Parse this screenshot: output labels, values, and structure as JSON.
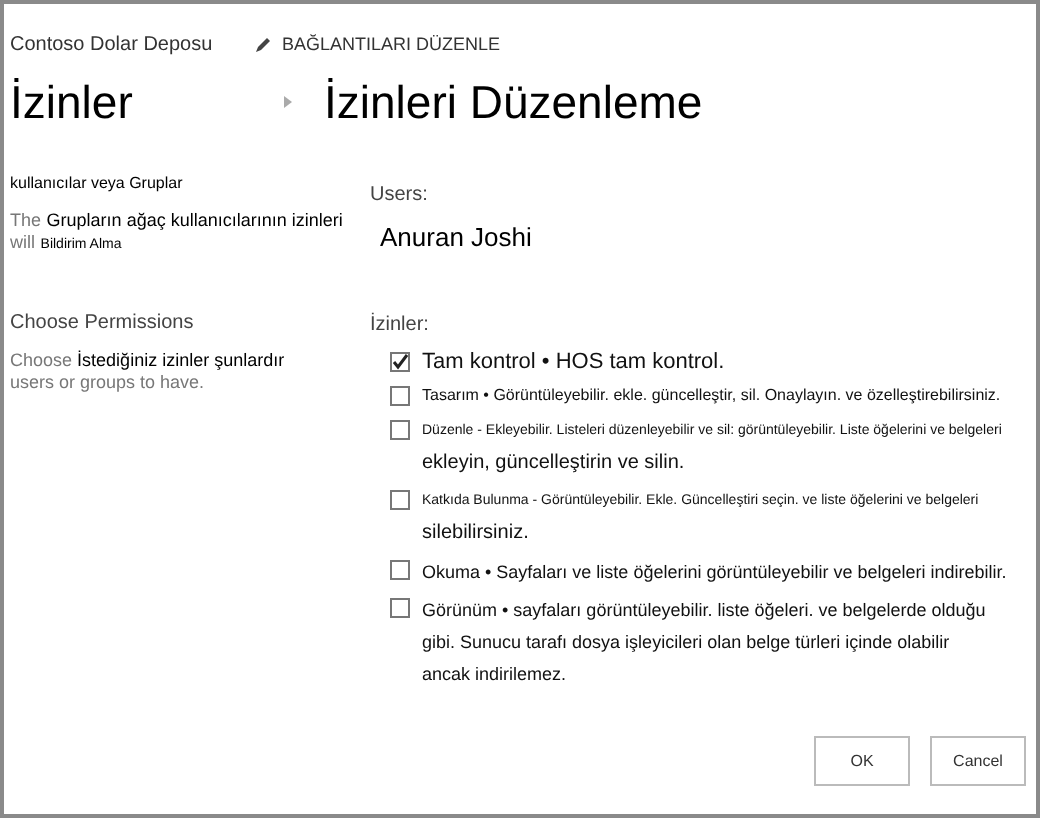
{
  "site_title": "Contoso Dolar Deposu",
  "edit_links": "BAĞLANTILARI DÜZENLE",
  "breadcrumb": {
    "parent": "İzinler",
    "current": "İzinleri Düzenleme"
  },
  "users_section": {
    "heading": "kullanıcılar veya Gruplar",
    "description": [
      {
        "text": "The",
        "kind": "note"
      },
      {
        "text": "Grupların ağaç kullanıcılarının izinleri",
        "kind": "strong"
      },
      {
        "text": "will",
        "kind": "note"
      },
      {
        "text": "Bildirim Alma",
        "kind": "fine"
      }
    ]
  },
  "permissions_section": {
    "heading": "Choose Permissions",
    "description": [
      {
        "text": "Choose",
        "kind": "note"
      },
      {
        "text": "İstediğiniz izinler şunlardır",
        "kind": "strong"
      },
      {
        "text": "users or groups to have.",
        "kind": "note"
      }
    ]
  },
  "users_label": "Users:",
  "user": "Anuran Joshi",
  "permissions_label": "İzinler:",
  "permissions": [
    {
      "kind": "large",
      "lines": [
        "Tam kontrol • HOS tam kontrol."
      ],
      "checked": true
    },
    {
      "kind": "small",
      "lines": [
        "Tasarım • Görüntüleyebilir. ekle. güncelleştir, sil. Onaylayın. ve özelleştirebilirsiniz."
      ],
      "checked": false
    },
    {
      "kind": "fine",
      "lines": [
        "Düzenle - Ekleyebilir. Listeleri düzenleyebilir ve sil: görüntüleyebilir. Liste öğelerini ve belgeleri",
        "ekleyin, güncelleştirin ve silin."
      ],
      "checked": false
    },
    {
      "kind": "fine",
      "lines": [
        "Katkıda Bulunma - Görüntüleyebilir. Ekle. Güncelleştiri seçin. ve liste öğelerini ve belgeleri",
        "silebilirsiniz."
      ],
      "checked": false
    },
    {
      "kind": "normal",
      "lines": [
        "Okuma • Sayfaları ve liste öğelerini görüntüleyebilir ve belgeleri indirebilir."
      ],
      "checked": false
    },
    {
      "kind": "normal",
      "lines": [
        "Görünüm • sayfaları görüntüleyebilir. liste öğeleri. ve belgelerde olduğu",
        "gibi. Sunucu tarafı dosya işleyicileri olan belge türleri içinde olabilir",
        "ancak indirilemez."
      ],
      "checked": false
    }
  ],
  "buttons": [
    "OK",
    "Cancel"
  ]
}
